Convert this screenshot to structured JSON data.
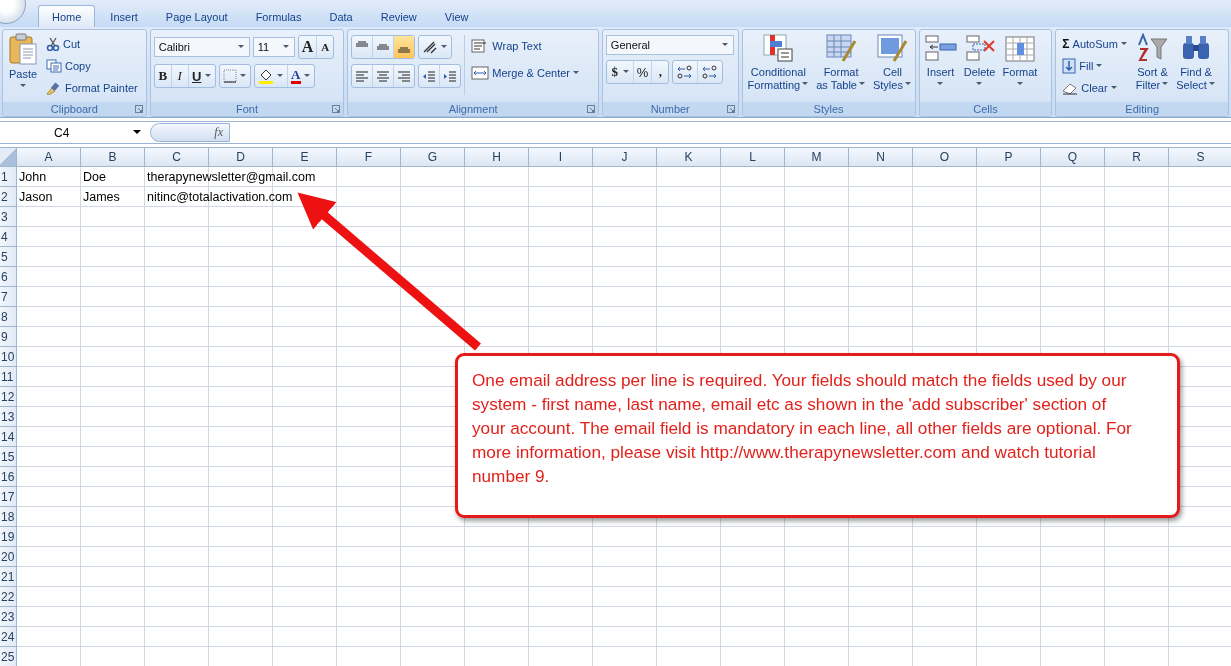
{
  "tabs": [
    {
      "label": "Home",
      "selected": true
    },
    {
      "label": "Insert",
      "selected": false
    },
    {
      "label": "Page Layout",
      "selected": false
    },
    {
      "label": "Formulas",
      "selected": false
    },
    {
      "label": "Data",
      "selected": false
    },
    {
      "label": "Review",
      "selected": false
    },
    {
      "label": "View",
      "selected": false
    }
  ],
  "ribbon": [
    {
      "kind": "clipboard",
      "label": "Clipboard",
      "paste": "Paste",
      "small": [
        "Cut",
        "Copy",
        "Format Painter"
      ]
    },
    {
      "kind": "font",
      "label": "Font",
      "font": "Calibri",
      "size": "11",
      "grow": "A",
      "shrink": "A",
      "bold": "B",
      "italic": "I",
      "underline": "U",
      "font_color": "A"
    },
    {
      "kind": "alignment",
      "label": "Alignment",
      "vertical": [
        {
          "selected": false
        },
        {
          "selected": false
        },
        {
          "selected": true
        }
      ],
      "wrap": "Wrap Text",
      "merge": "Merge & Center"
    },
    {
      "kind": "number",
      "label": "Number",
      "format": "General",
      "currency": "$",
      "percent": "%",
      "comma": ","
    },
    {
      "kind": "large",
      "label": "Styles",
      "buttons": [
        {
          "line1": "Conditional",
          "line2": "Formatting"
        },
        {
          "line1": "Format",
          "line2": "as Table"
        },
        {
          "line1": "Cell",
          "line2": "Styles"
        }
      ]
    },
    {
      "kind": "large",
      "label": "Cells",
      "buttons": [
        {
          "line1": "Insert"
        },
        {
          "line1": "Delete"
        },
        {
          "line1": "Format"
        }
      ]
    },
    {
      "kind": "editing",
      "label": "Editing",
      "sigma": "Σ",
      "small": [
        "AutoSum",
        "Fill",
        "Clear"
      ],
      "buttons": [
        {
          "line1": "Sort &",
          "line2": "Filter"
        },
        {
          "line1": "Find &",
          "line2": "Select"
        }
      ]
    }
  ],
  "formula_bar": {
    "name_box": "C4",
    "fx": "fx"
  },
  "sheet": {
    "columns": [
      "A",
      "B",
      "C",
      "D",
      "E",
      "F",
      "G",
      "H",
      "I",
      "J",
      "K",
      "L",
      "M",
      "N",
      "O",
      "P",
      "Q",
      "R",
      "S"
    ],
    "rows": [
      {
        "number": "1",
        "cells": [
          "John",
          "Doe",
          "therapynewsletter@gmail.com"
        ]
      },
      {
        "number": "2",
        "cells": [
          "Jason",
          "James",
          "nitinc@totalactivation.com"
        ]
      },
      {
        "number": "3"
      },
      {
        "number": "4"
      },
      {
        "number": "5"
      },
      {
        "number": "6"
      },
      {
        "number": "7"
      },
      {
        "number": "8"
      },
      {
        "number": "9"
      },
      {
        "number": "10"
      },
      {
        "number": "11"
      },
      {
        "number": "12"
      },
      {
        "number": "13"
      },
      {
        "number": "14"
      },
      {
        "number": "15"
      },
      {
        "number": "16"
      },
      {
        "number": "17"
      },
      {
        "number": "18"
      },
      {
        "number": "19"
      },
      {
        "number": "20"
      },
      {
        "number": "21"
      },
      {
        "number": "22"
      },
      {
        "number": "23"
      },
      {
        "number": "24"
      },
      {
        "number": "25"
      }
    ]
  },
  "callout": {
    "text": "One email address per line is required. Your fields should match the fields used by our system - first name, last name, email etc as shown in the 'add subscriber' section of your account. The email field is mandatory in each line, all other fields are optional. For more information, please visit http://www.therapynewsletter.com and watch tutorial number 9."
  }
}
